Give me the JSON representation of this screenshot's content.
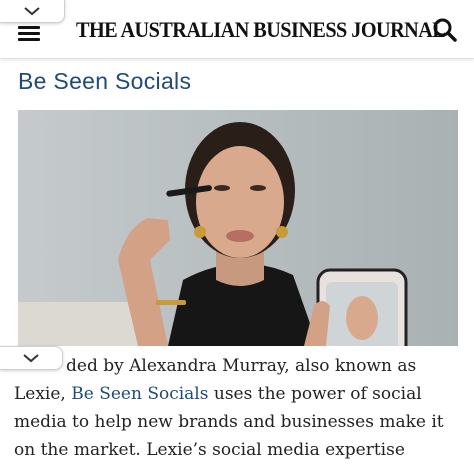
{
  "header": {
    "masthead": "THE AUSTRALIAN BUSINESS JOURNAL",
    "menu_icon": "hamburger-menu-icon",
    "search_icon": "search-icon",
    "collapse_icon": "chevron-down-icon"
  },
  "article": {
    "section_title": "Be Seen Socials",
    "image_icon": "photo",
    "body": {
      "line1": "ded by Alexandra Murray, also known as",
      "line2_before": "Lexie, ",
      "line2_link": "Be Seen Socials",
      "line2_after": " uses the power of social",
      "line3": "media to help new brands and businesses make it",
      "line4": "on the market. Lexie’s social media expertise"
    }
  },
  "colors": {
    "link": "#1f4a7a",
    "text": "#222222",
    "masthead": "#111111"
  }
}
